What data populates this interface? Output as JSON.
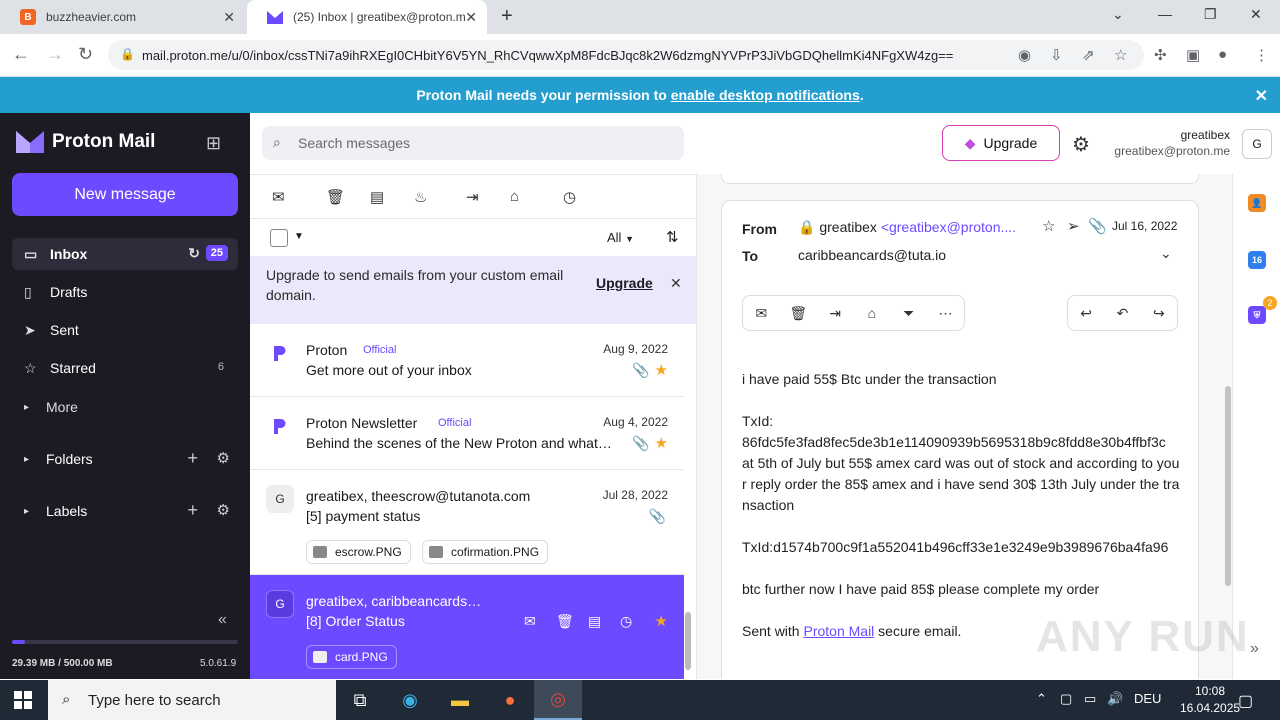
{
  "browser": {
    "tabs": [
      {
        "title": "buzzheavier.com",
        "favicon": "B"
      },
      {
        "title": "(25) Inbox | greatibex@proton.m",
        "favicon": "proton-icon"
      }
    ],
    "new_tab": "+",
    "url": "mail.proton.me/u/0/inbox/cssTNi7a9ihRXEgI0CHbitY6V5YN_RhCVqwwXpM8FdcBJqc8k2W6dzmgNYVPrP3JiVbGDQhellmKi4NFgXW4zg=="
  },
  "notification": {
    "text_before": "Proton Mail needs your permission to ",
    "link": "enable desktop notifications",
    "text_after": "."
  },
  "sidebar": {
    "brand": "Proton Mail",
    "new_message": "New message",
    "items": [
      {
        "label": "Inbox",
        "icon": "inbox-icon",
        "badge": "25"
      },
      {
        "label": "Drafts",
        "icon": "file-icon"
      },
      {
        "label": "Sent",
        "icon": "send-icon"
      },
      {
        "label": "Starred",
        "icon": "star-icon",
        "count": "6"
      },
      {
        "label": "More",
        "icon": "caret-right-icon"
      },
      {
        "label": "Folders",
        "icon": "caret-right-icon"
      },
      {
        "label": "Labels",
        "icon": "caret-right-icon"
      }
    ],
    "storage": "29.39 MB / 500.00 MB",
    "storage_fraction": 0.059,
    "version": "5.0.61.9"
  },
  "header": {
    "search_placeholder": "Search messages",
    "upgrade": "Upgrade",
    "account_name": "greatibex",
    "account_email": "greatibex@proton.me",
    "avatar": "G"
  },
  "list": {
    "filter": "All",
    "upgrade_banner": "Upgrade to send emails from your custom email domain.",
    "upgrade_link": "Upgrade",
    "messages": [
      {
        "avatar": "P",
        "from": "Proton",
        "official": "Official",
        "date": "Aug 9, 2022",
        "subject": "Get more out of your inbox"
      },
      {
        "avatar": "P",
        "from": "Proton Newsletter",
        "official": "Official",
        "date": "Aug 4, 2022",
        "subject": "Behind the scenes of the New Proton and what…"
      },
      {
        "avatar": "G",
        "from": "greatibex, theescrow@tutanota.com",
        "date": "Jul 28, 2022",
        "subject": "[5] payment status",
        "attachments": [
          "escrow.PNG",
          "cofirmation.PNG"
        ]
      },
      {
        "avatar": "G",
        "from": "greatibex, caribbeancards…",
        "subject": "[8] Order Status",
        "attachments": [
          "card.PNG"
        ]
      }
    ]
  },
  "reader": {
    "from_label": "From",
    "to_label": "To",
    "from_name": "greatibex",
    "from_email": "<greatibex@proton....",
    "to": "caribbeancards@tuta.io",
    "date": "Jul 16, 2022",
    "body": [
      "i have paid 55$ Btc under the transaction",
      "TxId:\n86fdc5fe3fad8fec5de3b1e114090939b5695318b9c8fdd8e30b4ffbf3c\nat 5th of July but 55$ amex card was out of stock and according to your reply order the 85$ amex and  i have send 30$  13th July under the transaction",
      "TxId:d1574b700c9f1a552041b496cff33e1e3249e9b3989676ba4fa96",
      "btc further now I have paid 85$ please complete my order"
    ],
    "signature_prefix": "Sent with ",
    "signature_link": "Proton Mail",
    "signature_suffix": " secure email."
  },
  "rail": {
    "badge": "2",
    "calendar_day": "16"
  },
  "watermark": "ANY RUN",
  "taskbar": {
    "search_placeholder": "Type here to search",
    "language": "DEU",
    "time": "10:08",
    "date": "16.04.2025"
  }
}
